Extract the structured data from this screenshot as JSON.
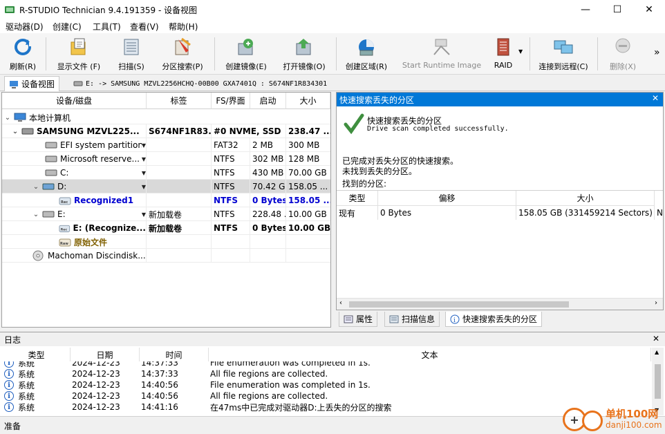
{
  "window": {
    "title": "R-STUDIO Technician 9.4.191359 - 设备视图",
    "minimize": "—",
    "maximize": "☐",
    "close": "✕"
  },
  "menu": [
    "驱动器(D)",
    "创建(C)",
    "工具(T)",
    "查看(V)",
    "帮助(H)"
  ],
  "toolbar": {
    "refresh": "刷新(R)",
    "show_files": "显示文件 (F)",
    "scan": "扫描(S)",
    "partition_search": "分区搜索(P)",
    "create_image": "创建镜像(E)",
    "open_image": "打开镜像(O)",
    "create_region": "创建区域(R)",
    "start_runtime_image": "Start Runtime Image",
    "raid": "RAID",
    "connect_remote": "连接到远程(C)",
    "delete": "删除(X)",
    "more": "»"
  },
  "tabs": {
    "device_view": "设备视图",
    "drive_tab": "E: -> SAMSUNG MZVL2256HCHQ-00B00 GXA7401Q : S674NF1R834301"
  },
  "tree": {
    "headers": [
      "设备/磁盘",
      "标签",
      "FS/界面",
      "启动",
      "大小"
    ],
    "rows": [
      {
        "name": "本地计算机",
        "label": "",
        "fs": "",
        "start": "",
        "size": ""
      },
      {
        "name": "SAMSUNG MZVL225...",
        "label": "S674NF1R83...",
        "fs": "#0 NVME, SSD",
        "start": "",
        "size": "238.47 ..."
      },
      {
        "name": "EFI system partition",
        "label": "",
        "fs": "FAT32",
        "start": "2 MB",
        "size": "300 MB"
      },
      {
        "name": "Microsoft reserve...",
        "label": "",
        "fs": "NTFS",
        "start": "302 MB",
        "size": "128 MB"
      },
      {
        "name": "C:",
        "label": "",
        "fs": "NTFS",
        "start": "430 MB",
        "size": "70.00 GB"
      },
      {
        "name": "D:",
        "label": "",
        "fs": "NTFS",
        "start": "70.42 GB",
        "size": "158.05 ..."
      },
      {
        "name": "Recognized1",
        "label": "",
        "fs": "NTFS",
        "start": "0 Bytes",
        "size": "158.05 ..."
      },
      {
        "name": "E:",
        "label": "新加载卷",
        "fs": "NTFS",
        "start": "228.48 ...",
        "size": "10.00 GB"
      },
      {
        "name": "E: (Recognize...",
        "label": "新加载卷",
        "fs": "NTFS",
        "start": "0 Bytes",
        "size": "10.00 GB"
      },
      {
        "name": "原始文件",
        "label": "",
        "fs": "",
        "start": "",
        "size": ""
      },
      {
        "name": "Machoman Discindisk...",
        "label": "",
        "fs": "",
        "start": "",
        "size": ""
      }
    ]
  },
  "quick_search": {
    "header": "快速搜索丢失的分区",
    "close": "✕",
    "title": "快速搜索丢失的分区",
    "subtitle": "Drive scan completed successfully.",
    "line1": "已完成对丢失分区的快速搜索。",
    "line2": "未找到丢失的分区。",
    "found_label": "找到的分区:",
    "columns": [
      "类型",
      "偏移",
      "大小"
    ],
    "row": {
      "type": "现有",
      "offset": "0 Bytes",
      "size": "158.05 GB (331459214 Sectors)",
      "extra": "N"
    }
  },
  "bottom_tabs": [
    "属性",
    "扫描信息",
    "快速搜索丢失的分区"
  ],
  "log": {
    "title": "日志",
    "close": "✕",
    "columns": [
      "类型",
      "日期",
      "时间",
      "文本"
    ],
    "rows": [
      {
        "type": "系统",
        "date": "2024-12-23",
        "time": "14:37:33",
        "text": "File enumeration was completed in 1s."
      },
      {
        "type": "系统",
        "date": "2024-12-23",
        "time": "14:37:33",
        "text": "All file regions are collected."
      },
      {
        "type": "系统",
        "date": "2024-12-23",
        "time": "14:40:56",
        "text": "File enumeration was completed in 1s."
      },
      {
        "type": "系统",
        "date": "2024-12-23",
        "time": "14:40:56",
        "text": "All file regions are collected."
      },
      {
        "type": "系统",
        "date": "2024-12-23",
        "time": "14:41:16",
        "text": "在47ms中已完成对驱动器D:上丢失的分区的搜索"
      }
    ]
  },
  "status": "准备",
  "watermark": {
    "name": "单机100网",
    "url": "danji100.com"
  },
  "colors": {
    "accent": "#0078d7",
    "recognized": "#0000d0",
    "raw": "#806000"
  }
}
